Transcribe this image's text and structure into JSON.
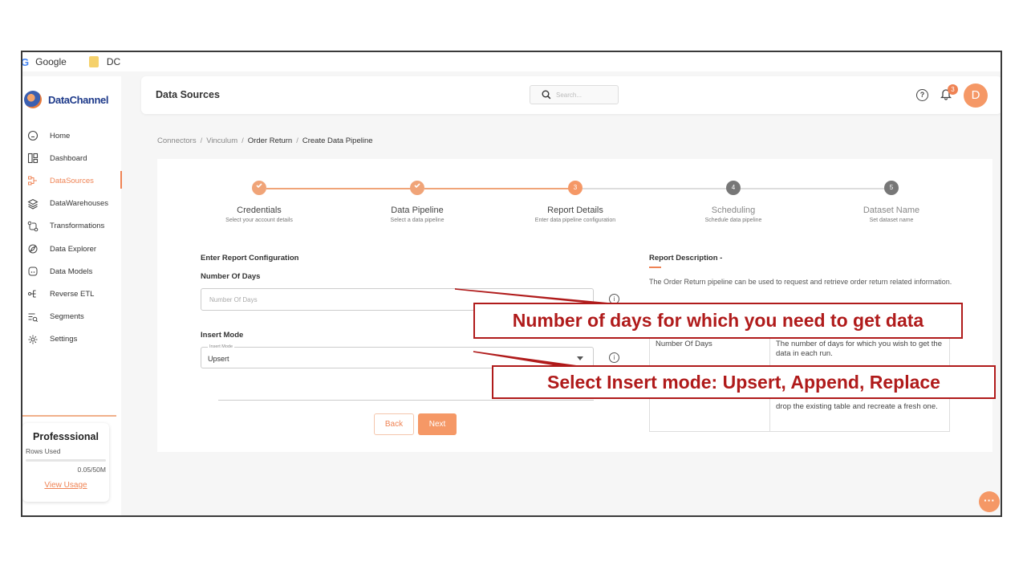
{
  "bookmarks": [
    {
      "label": "Google",
      "icon": "google-icon"
    },
    {
      "label": "DC",
      "icon": "folder-icon"
    }
  ],
  "brand": {
    "name": "DataChannel",
    "accent": "#ef8354"
  },
  "sidebar": {
    "items": [
      {
        "label": "Home",
        "icon": "home-icon"
      },
      {
        "label": "Dashboard",
        "icon": "dashboard-icon"
      },
      {
        "label": "DataSources",
        "icon": "datasources-icon",
        "active": true
      },
      {
        "label": "DataWarehouses",
        "icon": "layers-icon"
      },
      {
        "label": "Transformations",
        "icon": "transform-icon"
      },
      {
        "label": "Data Explorer",
        "icon": "explorer-icon"
      },
      {
        "label": "Data Models",
        "icon": "models-icon"
      },
      {
        "label": "Reverse ETL",
        "icon": "reverse-etl-icon"
      },
      {
        "label": "Segments",
        "icon": "segments-icon"
      },
      {
        "label": "Settings",
        "icon": "gear-icon"
      }
    ],
    "plan": {
      "name": "Professsional",
      "rows_label": "Rows Used",
      "rows_value": "0.05/50M",
      "rows_fraction": 0.001,
      "link": "View Usage"
    }
  },
  "header": {
    "title": "Data Sources",
    "search_placeholder": "Search...",
    "notifications": "3",
    "avatar_initial": "D"
  },
  "breadcrumb": [
    "Connectors",
    "Vinculum",
    "Order Return",
    "Create Data Pipeline"
  ],
  "steps": [
    {
      "number": "1",
      "title": "Credentials",
      "subtitle": "Select your account details",
      "state": "done"
    },
    {
      "number": "2",
      "title": "Data Pipeline",
      "subtitle": "Select a data pipeline",
      "state": "done"
    },
    {
      "number": "3",
      "title": "Report Details",
      "subtitle": "Enter data pipeline configuration",
      "state": "current"
    },
    {
      "number": "4",
      "title": "Scheduling",
      "subtitle": "Schedule data pipeline",
      "state": "pending"
    },
    {
      "number": "5",
      "title": "Dataset Name",
      "subtitle": "Set dataset name",
      "state": "pending"
    }
  ],
  "form": {
    "section_title": "Enter Report Configuration",
    "days_label": "Number Of Days",
    "days_placeholder": "Number Of Days",
    "mode_label": "Insert Mode",
    "mode_float_label": "Insert Mode",
    "mode_value": "Upsert",
    "back_label": "Back",
    "next_label": "Next"
  },
  "description": {
    "title": "Report Description -",
    "text": "The Order Return pipeline can be used to request and retrieve order return related information.",
    "table_key": "Number Of Days",
    "table_val1": "The number of days for which you wish to get the data in each run.",
    "table_val2": "drop the existing table and recreate a fresh one."
  },
  "annotations": {
    "days": "Number of days for which you need to get data",
    "mode": "Select Insert mode: Upsert, Append, Replace"
  }
}
